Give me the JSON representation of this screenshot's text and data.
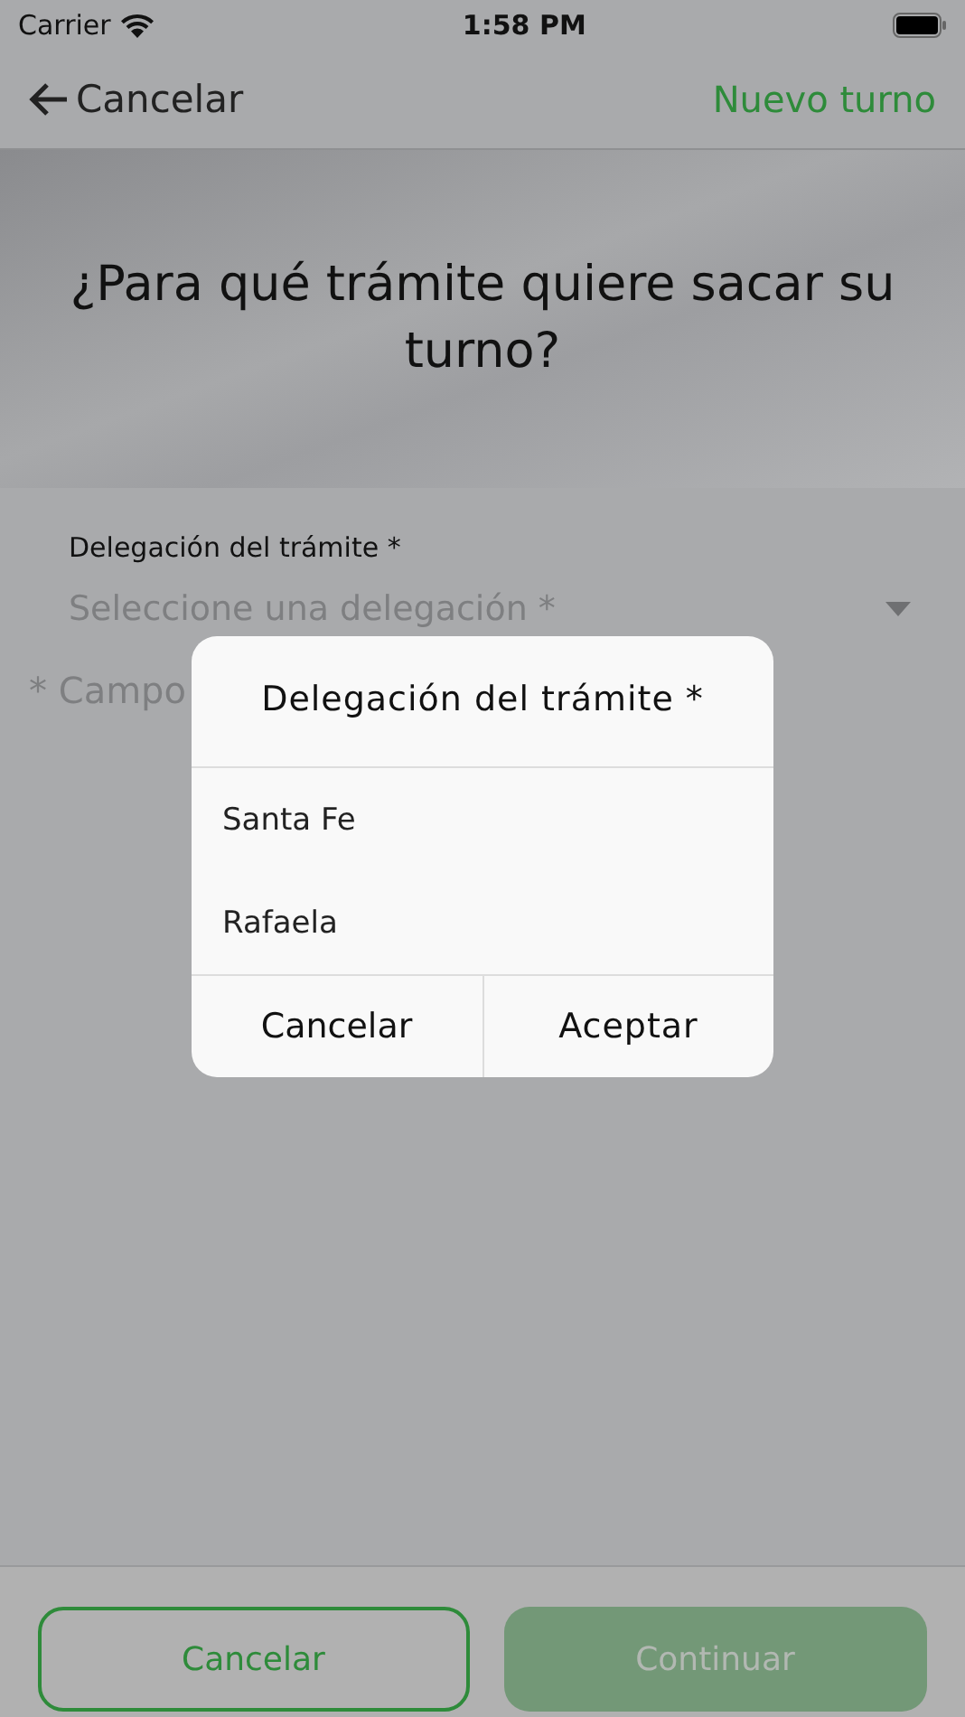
{
  "status_bar": {
    "carrier": "Carrier",
    "time": "1:58 PM"
  },
  "nav_bar": {
    "back_label": "Cancelar",
    "title": "Nuevo turno"
  },
  "header": {
    "question": "¿Para qué trámite quiere sacar su turno?"
  },
  "form": {
    "field_label": "Delegación del trámite *",
    "placeholder": "Seleccione una delegación *",
    "required_note": "* Campo"
  },
  "dialog": {
    "title": "Delegación del trámite *",
    "options": [
      {
        "label": "Santa Fe"
      },
      {
        "label": "Rafaela"
      }
    ],
    "buttons": [
      "Cancelar",
      "Aceptar"
    ]
  },
  "footer": {
    "cancel": "Cancelar",
    "continue": "Continuar",
    "continue_disabled": true
  }
}
